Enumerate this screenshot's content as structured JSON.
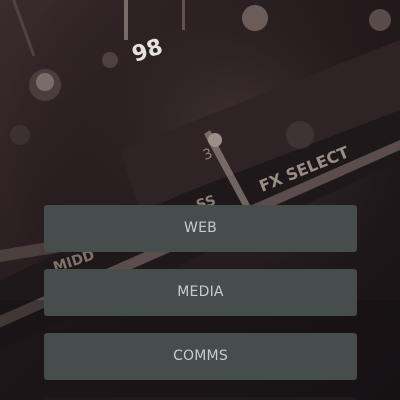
{
  "background": {
    "description_icon": "audio-mixer-photo",
    "printed_text": [
      "98",
      "FX SELECT",
      "3",
      "SS",
      "MIDD"
    ]
  },
  "menu": {
    "items": [
      {
        "label": "WEB"
      },
      {
        "label": "MEDIA"
      },
      {
        "label": "COMMS"
      },
      {
        "label": ""
      }
    ]
  },
  "colors": {
    "button_bg": "#454d4d",
    "button_text": "#c9cccb",
    "photo_tint": "#2a2022"
  }
}
